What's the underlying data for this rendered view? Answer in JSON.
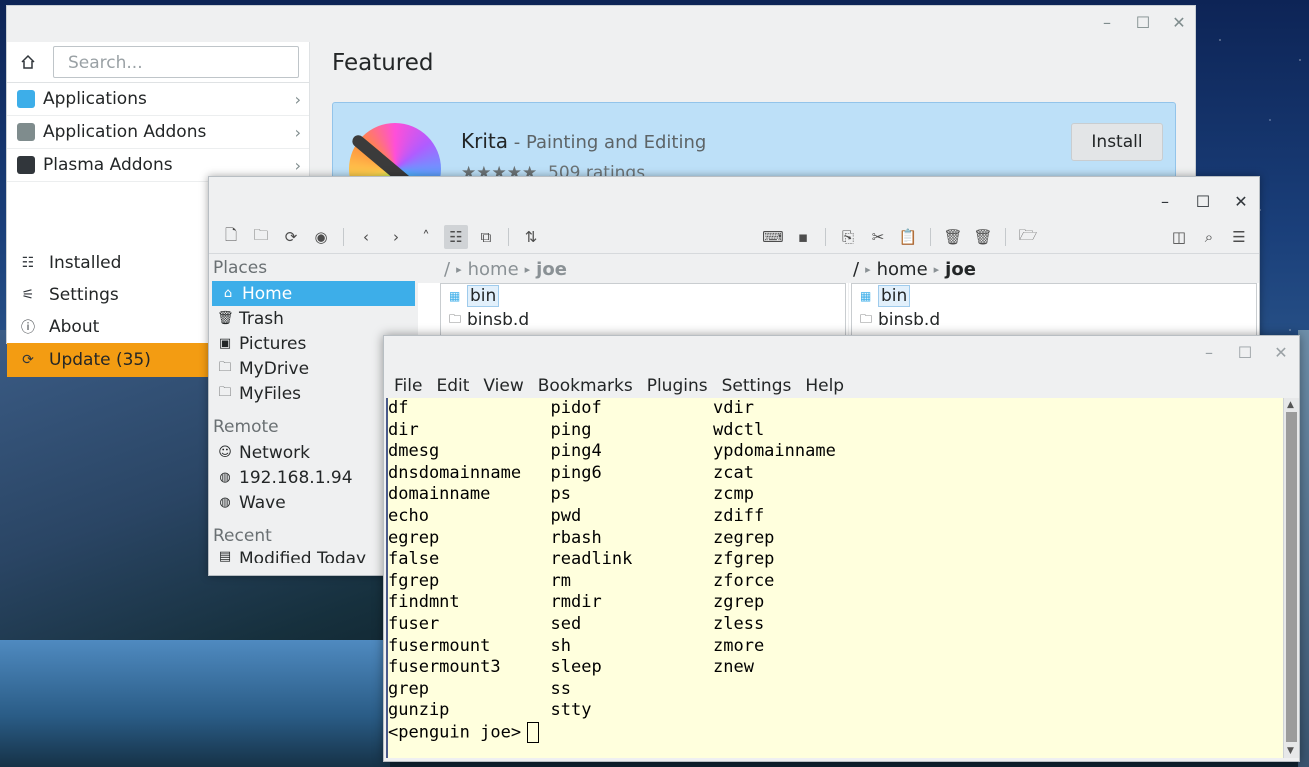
{
  "discover": {
    "search_placeholder": "Search...",
    "categories": [
      {
        "label": "Applications",
        "icon": "applications-icon",
        "color": "#3daee9"
      },
      {
        "label": "Application Addons",
        "icon": "addons-icon",
        "color": "#7f8c8d"
      },
      {
        "label": "Plasma Addons",
        "icon": "plasma-icon",
        "color": "#31363b"
      }
    ],
    "bottom": [
      {
        "label": "Installed",
        "icon": "installed-icon",
        "glyph": "☷"
      },
      {
        "label": "Settings",
        "icon": "settings-icon",
        "glyph": "⚟"
      },
      {
        "label": "About",
        "icon": "about-icon",
        "glyph": "ⓘ"
      },
      {
        "label": "Update (35)",
        "icon": "update-icon",
        "glyph": "⟳"
      }
    ],
    "featured_title": "Featured",
    "featured_app": {
      "name": "Krita",
      "subtitle": " - Painting and Editing",
      "stars": "★★★★★",
      "ratings": "509 ratings",
      "install_label": "Install"
    },
    "accent": "#f39c12"
  },
  "dolphin": {
    "places_head": "Places",
    "places": [
      {
        "label": "Home",
        "glyph": "⌂",
        "icon": "home-icon"
      },
      {
        "label": "Trash",
        "glyph": "🗑",
        "icon": "trash-icon"
      },
      {
        "label": "Pictures",
        "glyph": "▣",
        "icon": "pictures-icon"
      },
      {
        "label": "MyDrive",
        "glyph": "🗀",
        "icon": "folder-icon"
      },
      {
        "label": "MyFiles",
        "glyph": "🗀",
        "icon": "folder-icon"
      }
    ],
    "remote_head": "Remote",
    "remote": [
      {
        "label": "Network",
        "glyph": "☺",
        "icon": "network-icon"
      },
      {
        "label": "192.168.1.94",
        "glyph": "◍",
        "icon": "globe-icon"
      },
      {
        "label": "Wave",
        "glyph": "◍",
        "icon": "globe-icon"
      }
    ],
    "recent_head": "Recent",
    "recent_first": "Modified Today",
    "left_crumb": [
      "/",
      "home",
      "joe"
    ],
    "right_crumb": [
      "/",
      "home",
      "joe"
    ],
    "files": [
      "bin",
      "binsb.d"
    ]
  },
  "konsole": {
    "menu": [
      "File",
      "Edit",
      "View",
      "Bookmarks",
      "Plugins",
      "Settings",
      "Help"
    ],
    "rows": [
      [
        "df",
        "pidof",
        "vdir"
      ],
      [
        "dir",
        "ping",
        "wdctl"
      ],
      [
        "dmesg",
        "ping4",
        "ypdomainname"
      ],
      [
        "dnsdomainname",
        "ping6",
        "zcat"
      ],
      [
        "domainname",
        "ps",
        "zcmp"
      ],
      [
        "echo",
        "pwd",
        "zdiff"
      ],
      [
        "egrep",
        "rbash",
        "zegrep"
      ],
      [
        "false",
        "readlink",
        "zfgrep"
      ],
      [
        "fgrep",
        "rm",
        "zforce"
      ],
      [
        "findmnt",
        "rmdir",
        "zgrep"
      ],
      [
        "fuser",
        "sed",
        "zless"
      ],
      [
        "fusermount",
        "sh",
        "zmore"
      ],
      [
        "fusermount3",
        "sleep",
        "znew"
      ],
      [
        "grep",
        "ss",
        ""
      ],
      [
        "gunzip",
        "stty",
        ""
      ]
    ],
    "prompt": "<penguin joe>"
  }
}
